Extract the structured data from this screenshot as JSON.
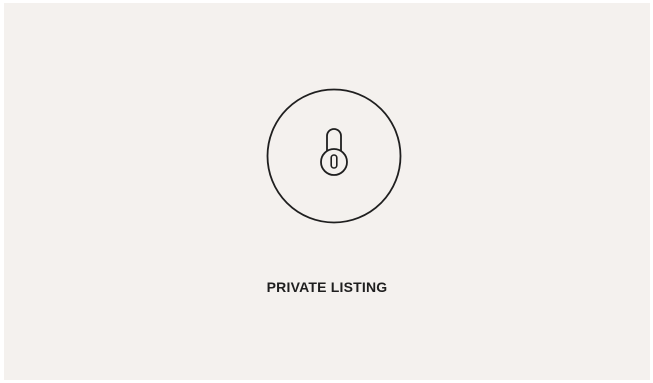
{
  "listing": {
    "status_label": "PRIVATE LISTING",
    "icon": "padlock-in-circle-icon"
  },
  "colors": {
    "background": "#f4f1ee",
    "stroke": "#1f1f1f"
  }
}
